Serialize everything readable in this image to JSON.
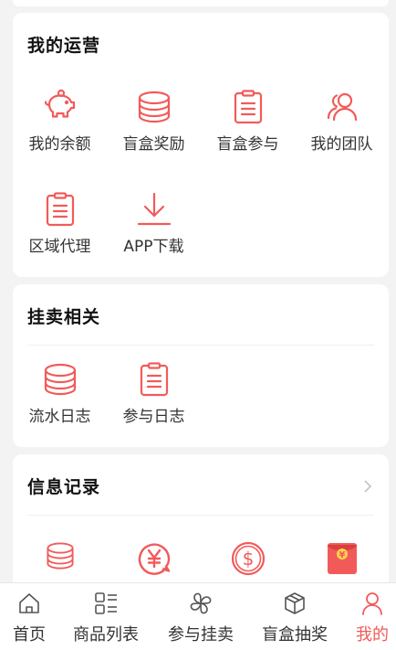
{
  "theme": {
    "accent": "#f25a5a",
    "text": "#333333",
    "background": "#f3f3f3"
  },
  "operations": {
    "title": "我的运营",
    "items": [
      {
        "label": "我的余额",
        "icon": "piggy-bank-icon"
      },
      {
        "label": "盲盒奖励",
        "icon": "coin-stack-icon"
      },
      {
        "label": "盲盒参与",
        "icon": "clipboard-icon"
      },
      {
        "label": "我的团队",
        "icon": "team-icon"
      },
      {
        "label": "区域代理",
        "icon": "clipboard-icon"
      },
      {
        "label": "APP下载",
        "icon": "download-icon"
      }
    ]
  },
  "sell": {
    "title": "挂卖相关",
    "items": [
      {
        "label": "流水日志",
        "icon": "coin-stack-icon"
      },
      {
        "label": "参与日志",
        "icon": "clipboard-icon"
      }
    ]
  },
  "info": {
    "title": "信息记录",
    "items": [
      {
        "icon": "coin-stack-icon"
      },
      {
        "icon": "yuan-bubble-icon"
      },
      {
        "icon": "dollar-circle-icon"
      },
      {
        "icon": "red-envelope-icon"
      }
    ]
  },
  "tabbar": {
    "tabs": [
      {
        "label": "首页",
        "icon": "home-icon"
      },
      {
        "label": "商品列表",
        "icon": "list-grid-icon"
      },
      {
        "label": "参与挂卖",
        "icon": "clover-icon"
      },
      {
        "label": "盲盒抽奖",
        "icon": "box-icon"
      },
      {
        "label": "我的",
        "icon": "user-icon",
        "active": true
      }
    ]
  }
}
